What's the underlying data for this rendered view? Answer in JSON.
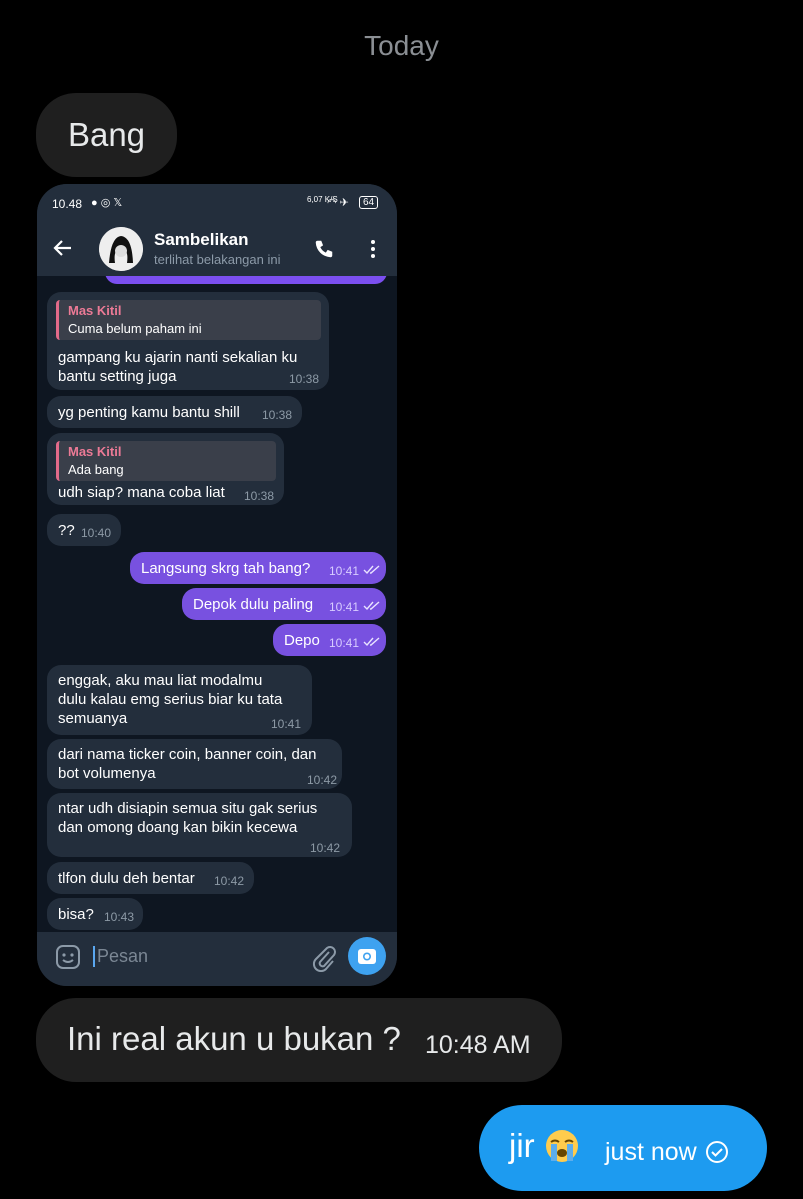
{
  "thread": {
    "date_separator": "Today",
    "messages": [
      {
        "text": "Bang"
      },
      {
        "text": "Ini real akun u bukan ?",
        "time": "10:48 AM"
      },
      {
        "text": "jir",
        "emoji": "loudly-crying-face",
        "time": "just now",
        "status": "sent"
      }
    ]
  },
  "screenshot": {
    "status": {
      "time": "10.48",
      "net": "6,07 K/S",
      "battery": "64"
    },
    "contact": {
      "name": "Sambelikan",
      "status": "terlihat belakangan ini"
    },
    "messages": [
      {
        "reply_name": "Mas Kitil",
        "reply_text": "Cuma belum paham ini",
        "line1": "gampang ku ajarin nanti sekalian ku",
        "line2": "bantu setting juga",
        "time": "10:38"
      },
      {
        "line1": "yg penting kamu bantu shill",
        "time": "10:38"
      },
      {
        "reply_name": "Mas Kitil",
        "reply_text": "Ada bang",
        "line1": "udh siap? mana coba liat",
        "time": "10:38"
      },
      {
        "line1": "??",
        "time": "10:40"
      },
      {
        "line1": "Langsung skrg tah bang?",
        "time": "10:41"
      },
      {
        "line1": "Depok dulu paling",
        "time": "10:41"
      },
      {
        "line1": "Depo",
        "time": "10:41"
      },
      {
        "line1": "enggak, aku mau liat modalmu",
        "line2": "dulu kalau emg serius biar ku tata",
        "line3": "semuanya",
        "time": "10:41"
      },
      {
        "line1": "dari nama ticker coin, banner coin, dan",
        "line2": "bot volumenya",
        "time": "10:42"
      },
      {
        "line1": "ntar udh disiapin semua situ gak serius",
        "line2": "dan omong doang kan bikin kecewa",
        "time": "10:42"
      },
      {
        "line1": "tlfon dulu deh bentar",
        "time": "10:42"
      },
      {
        "line1": "bisa?",
        "time": "10:43"
      }
    ],
    "input_placeholder": "Pesan"
  },
  "colors": {
    "outgoing_bubble": "#1d9bf0",
    "incoming_bubble": "#1f1f1f",
    "tg_outgoing": "#7851e0",
    "tg_incoming": "#232e3c"
  }
}
